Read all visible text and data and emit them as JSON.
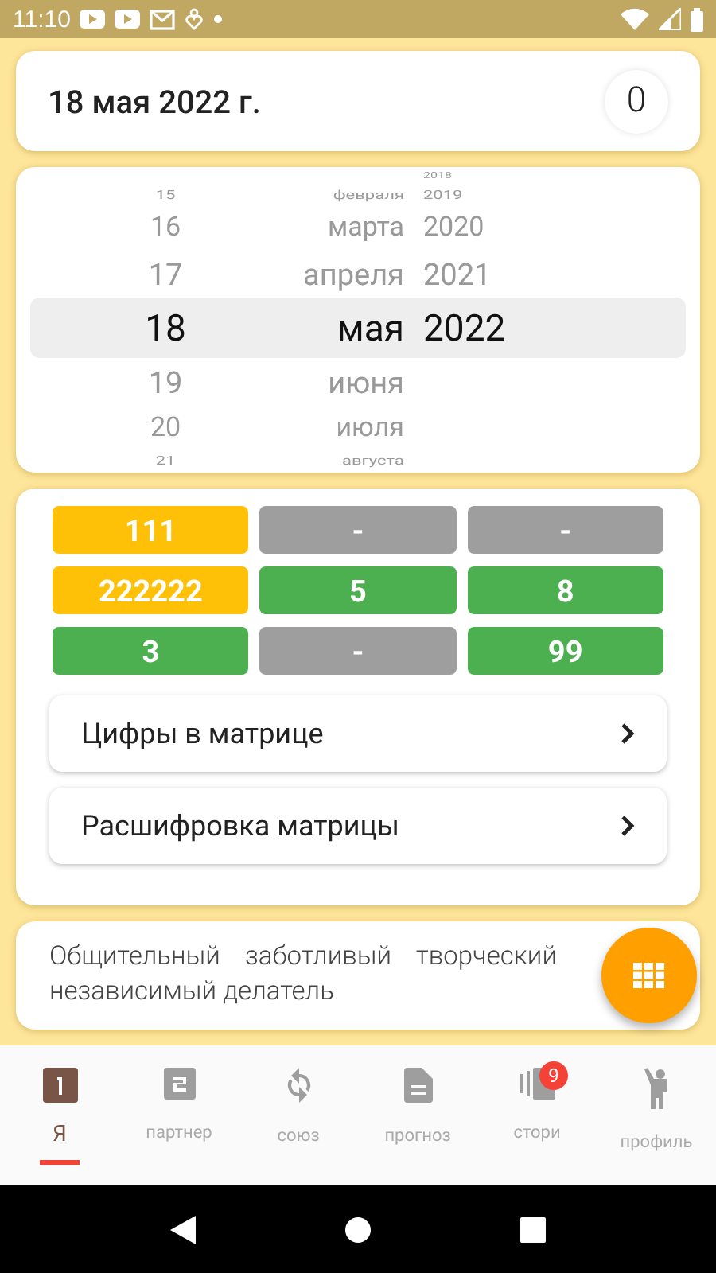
{
  "status_bar": {
    "time": "11:10"
  },
  "date_card": {
    "date": "18 мая 2022 г.",
    "counter": "0"
  },
  "picker": {
    "columns": [
      {
        "kind": "day",
        "items": [
          {
            "text": "15",
            "selected": false
          },
          {
            "text": "16",
            "selected": false
          },
          {
            "text": "17",
            "selected": false
          },
          {
            "text": "18",
            "selected": true
          },
          {
            "text": "19",
            "selected": false
          },
          {
            "text": "20",
            "selected": false
          },
          {
            "text": "21",
            "selected": false
          }
        ]
      },
      {
        "kind": "month",
        "items": [
          {
            "text": "февраля",
            "selected": false
          },
          {
            "text": "марта",
            "selected": false
          },
          {
            "text": "апреля",
            "selected": false
          },
          {
            "text": "мая",
            "selected": true
          },
          {
            "text": "июня",
            "selected": false
          },
          {
            "text": "июля",
            "selected": false
          },
          {
            "text": "августа",
            "selected": false
          }
        ]
      },
      {
        "kind": "year",
        "items": [
          {
            "text": "2018",
            "selected": false
          },
          {
            "text": "2019",
            "selected": false
          },
          {
            "text": "2020",
            "selected": false
          },
          {
            "text": "2021",
            "selected": false
          },
          {
            "text": "2022",
            "selected": true
          }
        ]
      }
    ]
  },
  "matrix": {
    "cells": [
      {
        "text": "111",
        "color": "#ffc107"
      },
      {
        "text": "-",
        "color": "#9e9e9e"
      },
      {
        "text": "-",
        "color": "#9e9e9e"
      },
      {
        "text": "222222",
        "color": "#ffc107"
      },
      {
        "text": "5",
        "color": "#4caf50"
      },
      {
        "text": "8",
        "color": "#4caf50"
      },
      {
        "text": "3",
        "color": "#4caf50"
      },
      {
        "text": "-",
        "color": "#9e9e9e"
      },
      {
        "text": "99",
        "color": "#4caf50"
      }
    ],
    "links": [
      "Цифры в матрице",
      "Расшифровка матрицы"
    ]
  },
  "description": "Общительный заботливый творческий независимый делатель",
  "bottom_nav": [
    {
      "label": "Я",
      "kind": "one",
      "selected": true
    },
    {
      "label": "партнер",
      "kind": "two",
      "selected": false
    },
    {
      "label": "союз",
      "kind": "sync",
      "selected": false
    },
    {
      "label": "прогноз",
      "kind": "doc",
      "selected": false
    },
    {
      "label": "стори",
      "kind": "stories",
      "selected": false,
      "badge": "9"
    },
    {
      "label": "профиль",
      "kind": "person",
      "selected": false
    }
  ]
}
